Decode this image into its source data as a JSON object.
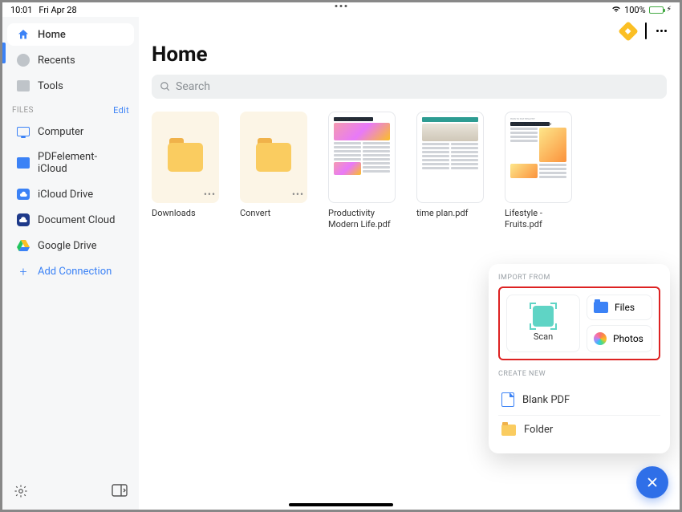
{
  "status": {
    "time": "10:01",
    "date": "Fri Apr 28",
    "battery_pct": "100%"
  },
  "sidebar": {
    "nav": [
      {
        "label": "Home"
      },
      {
        "label": "Recents"
      },
      {
        "label": "Tools"
      }
    ],
    "files_header": "FILES",
    "edit_label": "Edit",
    "locations": [
      {
        "label": "Computer"
      },
      {
        "label": "PDFelement-iCloud"
      },
      {
        "label": "iCloud Drive"
      },
      {
        "label": "Document Cloud"
      },
      {
        "label": "Google Drive"
      }
    ],
    "add_connection": "Add Connection"
  },
  "main": {
    "title": "Home",
    "search_placeholder": "Search",
    "items": [
      {
        "label": "Downloads",
        "type": "folder"
      },
      {
        "label": "Convert",
        "type": "folder"
      },
      {
        "label": "Productivity Modern Life.pdf",
        "type": "doc"
      },
      {
        "label": "time plan.pdf",
        "type": "doc"
      },
      {
        "label": "Lifestyle - Fruits.pdf",
        "type": "doc"
      }
    ]
  },
  "doc_previews": {
    "productivity_heading": "PROMOTE PRODUCTIVITY",
    "lifestyle_heading": "AND FEEL GOOD EVERY DAY",
    "lifestyle_subheading": "HOW TO EAT HEALTHY"
  },
  "popover": {
    "import_label": "IMPORT FROM",
    "scan_label": "Scan",
    "files_label": "Files",
    "photos_label": "Photos",
    "create_label": "CREATE NEW",
    "blank_pdf_label": "Blank PDF",
    "folder_label": "Folder"
  }
}
